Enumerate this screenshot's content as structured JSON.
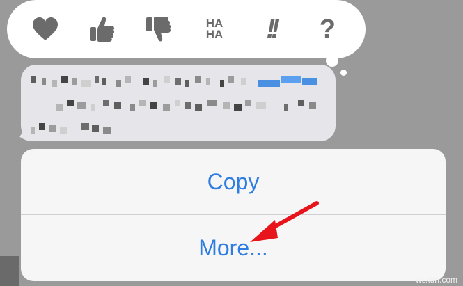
{
  "tapbacks": {
    "items": [
      {
        "icon": "heart-icon"
      },
      {
        "icon": "thumbs-up-icon"
      },
      {
        "icon": "thumbs-down-icon"
      },
      {
        "icon": "haha-icon",
        "line1": "HA",
        "line2": "HA"
      },
      {
        "icon": "exclamation-icon",
        "text": "!!"
      },
      {
        "icon": "question-icon",
        "text": "?"
      }
    ],
    "icon_color": "#6b6b6b"
  },
  "message": {
    "content": "pixelated/blurred text",
    "bubble_color": "#e5e5ea"
  },
  "action_sheet": {
    "copy_label": "Copy",
    "more_label": "More...",
    "text_color": "#2f7de1"
  },
  "annotation": {
    "arrow_color": "#e8141c"
  },
  "watermark": "wsxdn.com"
}
